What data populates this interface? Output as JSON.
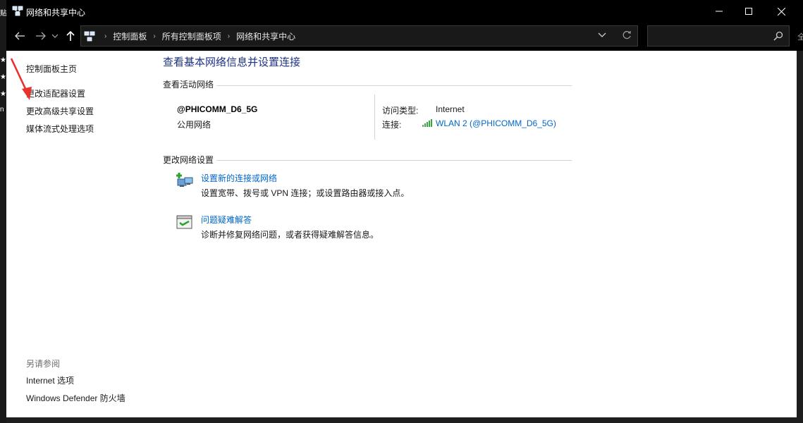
{
  "window": {
    "title": "网络和共享中心"
  },
  "address": {
    "breadcrumbs": [
      "控制面板",
      "所有控制面板项",
      "网络和共享中心"
    ],
    "search_placeholder": ""
  },
  "sidebar": {
    "links": [
      "控制面板主页",
      "更改适配器设置",
      "更改高级共享设置",
      "媒体流式处理选项"
    ],
    "see_also_label": "另请参阅",
    "see_also": [
      "Internet 选项",
      "Windows Defender 防火墙"
    ]
  },
  "main": {
    "heading": "查看基本网络信息并设置连接",
    "active_networks_label": "查看活动网络",
    "network": {
      "name": "@PHICOMM_D6_5G",
      "category": "公用网络",
      "access_type_label": "访问类型:",
      "access_type_value": "Internet",
      "connection_label": "连接:",
      "connection_value": "WLAN 2 (@PHICOMM_D6_5G)"
    },
    "change_settings_label": "更改网络设置",
    "tasks": [
      {
        "title": "设置新的连接或网络",
        "desc": "设置宽带、拨号或 VPN 连接；或设置路由器或接入点。",
        "icon": "new-connection-icon"
      },
      {
        "title": "问题疑难解答",
        "desc": "诊断并修复网络问题，或者获得疑难解答信息。",
        "icon": "troubleshoot-icon"
      }
    ]
  },
  "edge": {
    "left_chars": [
      "贴",
      "★",
      "★",
      "★",
      "n"
    ],
    "right_char": "全"
  },
  "colors": {
    "accent_link": "#0066cc",
    "heading": "#1e3287",
    "annotation_arrow": "#e8322f"
  }
}
